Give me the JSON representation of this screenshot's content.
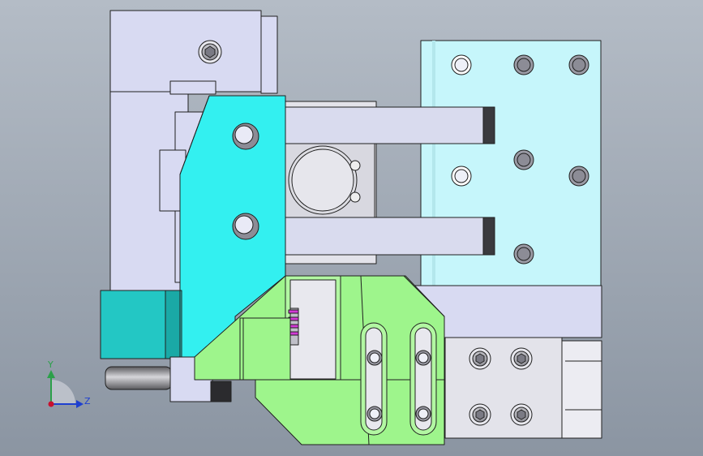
{
  "viewport": {
    "background_top": "#b4bcc6",
    "background_bottom": "#8b95a2"
  },
  "triad": {
    "y_label": "Y",
    "z_label": "Z",
    "y_color": "#2ca04a",
    "z_color": "#1e3fd0",
    "origin_color": "#c8102e"
  },
  "colors": {
    "housing": "#d8daf2",
    "cyan_plate": "#33f0f0",
    "teal_block": "#23c7c4",
    "light_cyan_plate": "#c6f6fb",
    "green_bracket": "#9ef58c",
    "rod": "#d9dbee",
    "grey_block": "#e3e3ea",
    "edge": "#202020",
    "hole": "#8c8c96"
  }
}
